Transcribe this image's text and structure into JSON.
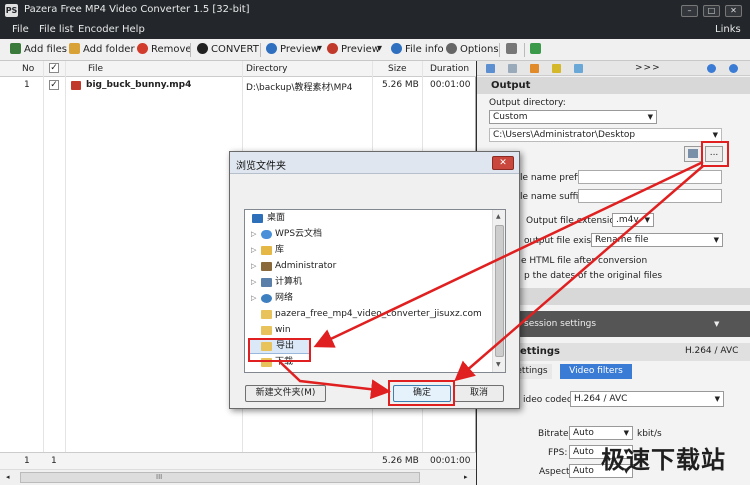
{
  "window": {
    "title": "Pazera Free MP4 Video Converter 1.5  [32-bit]",
    "app_icon": "PS",
    "min": "–",
    "max": "□",
    "close": "✕"
  },
  "menu": {
    "file": "File",
    "file_list": "File list",
    "encoder": "Encoder",
    "help": "Help",
    "links": "Links"
  },
  "toolbar": {
    "add_files": "Add files",
    "add_folder": "Add folder",
    "remove": "Remove",
    "convert": "CONVERT",
    "preview1": "Preview",
    "preview2": "Preview",
    "file_info": "File info",
    "options": "Options",
    "dropdown": "▾"
  },
  "table": {
    "headers": {
      "no": "No",
      "check": "✓",
      "file": "File",
      "directory": "Directory",
      "size": "Size",
      "duration": "Duration"
    },
    "rows": [
      {
        "no": "1",
        "check": "✓",
        "file": "big_buck_bunny.mp4",
        "directory": "D:\\backup\\教程素材\\MP4",
        "size": "5.26 MB",
        "duration": "00:01:00"
      }
    ],
    "footer": {
      "count": "1",
      "checked": "1",
      "size": "5.26 MB",
      "duration": "00:01:00"
    },
    "scroll_mark": "III"
  },
  "panel": {
    "more_tabs": ">>>",
    "output_header": "Output",
    "output_directory_label": "Output directory:",
    "output_directory_mode": "Custom",
    "output_path": "C:\\Users\\Administrator\\Desktop",
    "browse_button": "...",
    "prefix_label": "le name prefix:",
    "suffix_label": "le name suffix:",
    "extension_label": "Output file extension:",
    "extension_value": ".m4v",
    "exists_label": "output file exists:",
    "exists_value": "Rename file",
    "html_label": "e HTML file after conversion",
    "dates_label": "p the dates of the original files",
    "session_label": "session settings",
    "settings_header": "ettings",
    "codec_badge": "H.264 / AVC",
    "tab_settings": "ettings",
    "tab_video_filters": "Video filters",
    "video_codec_label": "ideo codec:",
    "video_codec_value": "H.264 / AVC",
    "bitrate_label": "Bitrate:",
    "bitrate_value": "Auto",
    "bitrate_unit": "kbit/s",
    "fps_label": "FPS:",
    "fps_value": "Auto",
    "aspect_label": "Aspect:",
    "aspect_value": "Auto"
  },
  "dialog": {
    "title": "浏览文件夹",
    "close": "✕",
    "tree": [
      {
        "label": "桌面",
        "expander": ""
      },
      {
        "label": "WPS云文档",
        "expander": "▷"
      },
      {
        "label": "库",
        "expander": "▷"
      },
      {
        "label": "Administrator",
        "expander": "▷"
      },
      {
        "label": "计算机",
        "expander": "▷"
      },
      {
        "label": "网络",
        "expander": "▷"
      },
      {
        "label": "pazera_free_mp4_video_converter_jisuxz.com",
        "expander": ""
      },
      {
        "label": "win",
        "expander": ""
      },
      {
        "label": "导出",
        "expander": ""
      },
      {
        "label": "下载",
        "expander": ""
      }
    ],
    "new_folder": "新建文件夹(M)",
    "ok": "确定",
    "cancel": "取消"
  },
  "watermark": "极速下载站"
}
